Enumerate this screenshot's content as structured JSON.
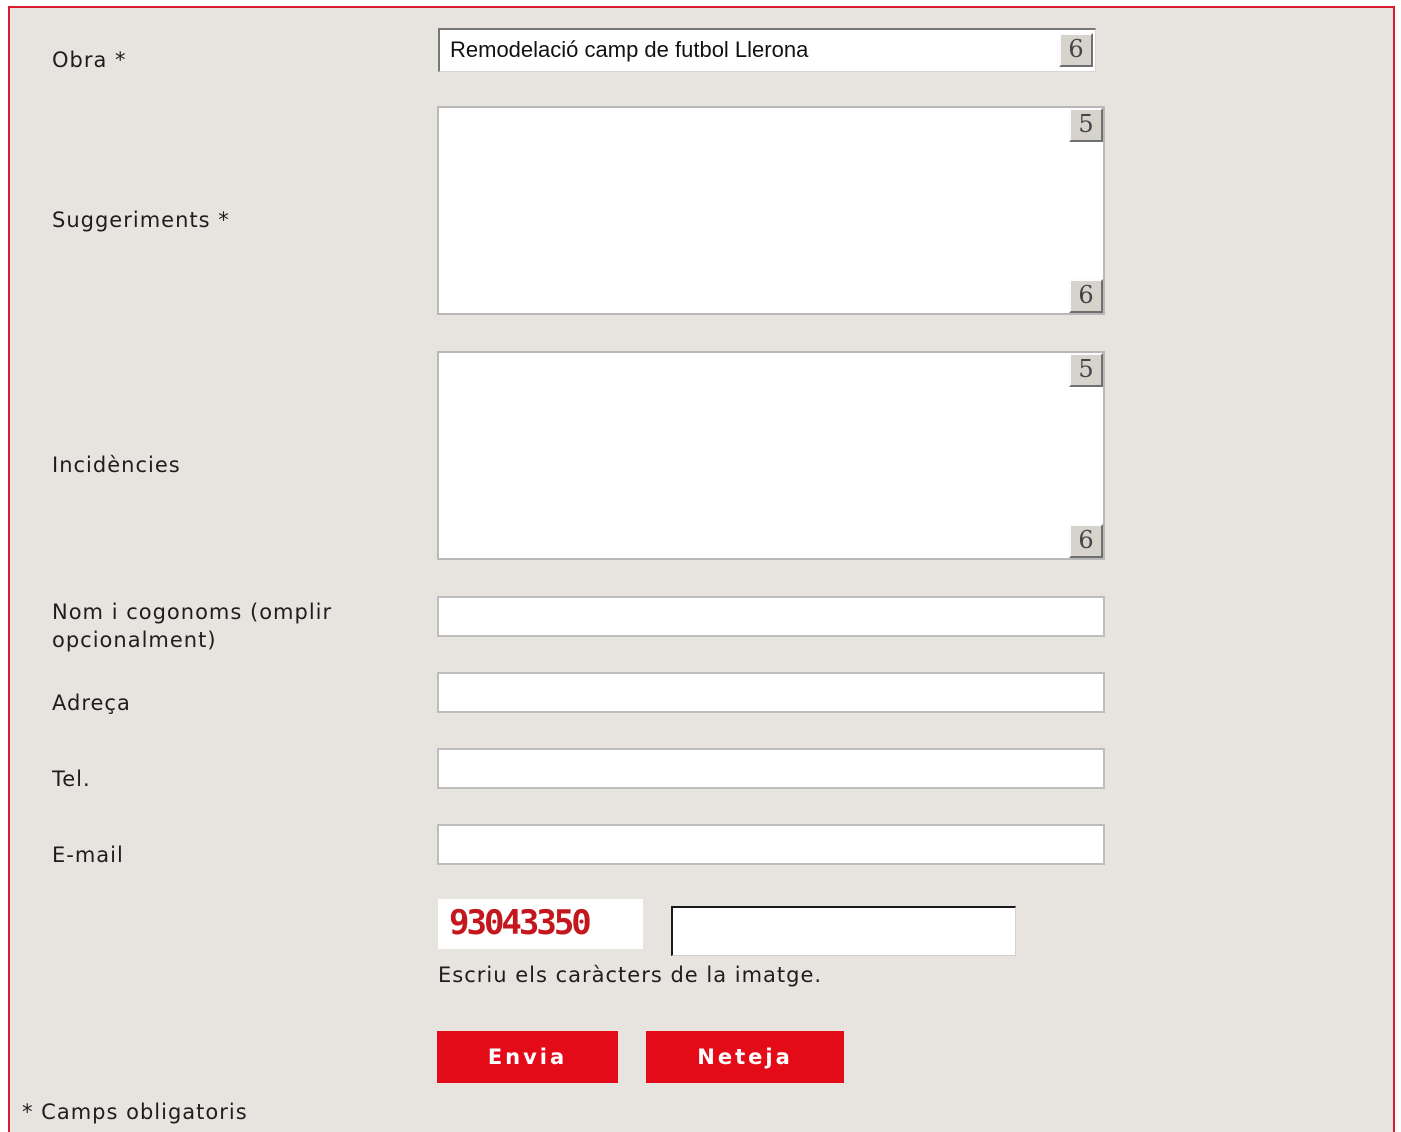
{
  "form": {
    "obra": {
      "label": "Obra *",
      "selected_value": "Remodelació camp de futbol Llerona",
      "dropdown_glyph": "6"
    },
    "suggeriments": {
      "label": "Suggeriments *",
      "value": "",
      "scroll_up_glyph": "5",
      "scroll_down_glyph": "6"
    },
    "incidencies": {
      "label": "Incidències",
      "value": "",
      "scroll_up_glyph": "5",
      "scroll_down_glyph": "6"
    },
    "nom": {
      "label_line1": "Nom i cogonoms (omplir",
      "label_line2": "opcionalment)",
      "value": ""
    },
    "adreca": {
      "label": "Adreça",
      "value": ""
    },
    "tel": {
      "label": "Tel.",
      "value": ""
    },
    "email": {
      "label": "E-mail",
      "value": ""
    },
    "captcha": {
      "image_text": "93043350",
      "hint": "Escriu els caràcters de la imatge.",
      "value": ""
    },
    "buttons": {
      "send_label": "Envia",
      "reset_label": "Neteja"
    },
    "footnote": "* Camps obligatoris"
  },
  "colors": {
    "panel_background": "#e7e3de",
    "panel_border": "#d91c2b",
    "button_background": "#e30b17",
    "captcha_text": "#c4161d"
  }
}
